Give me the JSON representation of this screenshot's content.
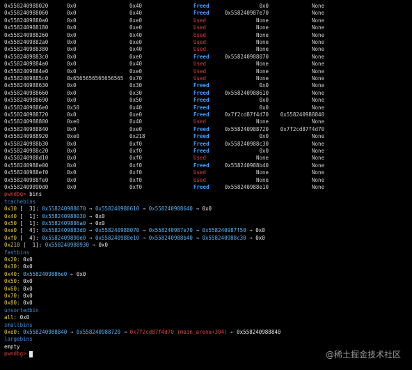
{
  "heap_rows": [
    [
      "0x558240988020",
      "0x0",
      "0x40",
      "Freed",
      "0x0",
      "None"
    ],
    [
      "0x558240988060",
      "0x0",
      "0x40",
      "Freed",
      "0x558240987e70",
      "None"
    ],
    [
      "0x5582409880a0",
      "0x0",
      "0xe0",
      "Used",
      "None",
      "None"
    ],
    [
      "0x558240988180",
      "0x0",
      "0xe0",
      "Used",
      "None",
      "None"
    ],
    [
      "0x558240988260",
      "0x0",
      "0x40",
      "Used",
      "None",
      "None"
    ],
    [
      "0x5582409882a0",
      "0x0",
      "0xe0",
      "Used",
      "None",
      "None"
    ],
    [
      "0x558240988380",
      "0x0",
      "0x40",
      "Used",
      "None",
      "None"
    ],
    [
      "0x5582409883c0",
      "0x0",
      "0xe0",
      "Freed",
      "0x558240988070",
      "None"
    ],
    [
      "0x5582409884a0",
      "0x0",
      "0x40",
      "Used",
      "None",
      "None"
    ],
    [
      "0x5582409884e0",
      "0x0",
      "0xe0",
      "Used",
      "None",
      "None"
    ],
    [
      "0x5582409885c0",
      "0x6565656565656565",
      "0x70",
      "Used",
      "None",
      "None"
    ],
    [
      "0x558240988630",
      "0x0",
      "0x30",
      "Freed",
      "0x0",
      "None"
    ],
    [
      "0x558240988660",
      "0x0",
      "0x30",
      "Freed",
      "0x558240988610",
      "None"
    ],
    [
      "0x558240988690",
      "0x0",
      "0x50",
      "Freed",
      "0x0",
      "None"
    ],
    [
      "0x5582409886e0",
      "0x50",
      "0x40",
      "Freed",
      "0x0",
      "None"
    ],
    [
      "0x558240988720",
      "0x0",
      "0xe0",
      "Freed",
      "0x7f2cd87f4d70",
      "0x558240988840"
    ],
    [
      "0x558240988800",
      "0xe0",
      "0x40",
      "Used",
      "None",
      "None"
    ],
    [
      "0x558240988840",
      "0x0",
      "0xe0",
      "Freed",
      "0x558240988720",
      "0x7f2cd87f4d70"
    ],
    [
      "0x558240988920",
      "0xe0",
      "0x218",
      "Freed",
      "0x0",
      "None"
    ],
    [
      "0x558240988b30",
      "0x0",
      "0xf0",
      "Freed",
      "0x558240988c30",
      "None"
    ],
    [
      "0x558240988c20",
      "0x0",
      "0xf0",
      "Freed",
      "0x0",
      "None"
    ],
    [
      "0x558240988d10",
      "0x0",
      "0xf0",
      "Used",
      "None",
      "None"
    ],
    [
      "0x558240988e00",
      "0x0",
      "0xf0",
      "Freed",
      "0x558240988b40",
      "None"
    ],
    [
      "0x558240988ef0",
      "0x0",
      "0xf0",
      "Used",
      "None",
      "None"
    ],
    [
      "0x558240988fe0",
      "0x0",
      "0xf0",
      "Used",
      "None",
      "None"
    ],
    [
      "0x5582409890d0",
      "0x0",
      "0xf0",
      "Freed",
      "0x558240988e10",
      "None"
    ]
  ],
  "prompt": "pwndbg>",
  "command": "bins",
  "tcache": {
    "title": "tcachebins",
    "rows": [
      {
        "key": "0x30",
        "count": "[  3]:",
        "chain": [
          "0x558240988670",
          "0x558240988610",
          "0x558240988640",
          "0x0"
        ]
      },
      {
        "key": "0x40",
        "count": "[  1]:",
        "chain": [
          "0x558240988030",
          "0x0"
        ]
      },
      {
        "key": "0x50",
        "count": "[  1]:",
        "chain": [
          "0x5582409886a0",
          "0x0"
        ]
      },
      {
        "key": "0xe0",
        "count": "[  4]:",
        "chain": [
          "0x5582409883d0",
          "0x558240988070",
          "0x558240987e70",
          "0x558240987f50",
          "0x0"
        ]
      },
      {
        "key": "0xf0",
        "count": "[  4]:",
        "chain": [
          "0x5582409890e0",
          "0x558240988e10",
          "0x558240988b40",
          "0x558240988c30",
          "0x0"
        ]
      },
      {
        "key": "0x210",
        "count": "[  1]:",
        "chain": [
          "0x558240988930",
          "0x0"
        ]
      }
    ]
  },
  "fastbins": {
    "title": "fastbins",
    "rows": [
      {
        "key": "0x20:",
        "value": "0x0"
      },
      {
        "key": "0x30:",
        "value": "0x0"
      },
      {
        "key": "0x40:",
        "value": "0x5582409886e0",
        "tail": "0x0"
      },
      {
        "key": "0x50:",
        "value": "0x0"
      },
      {
        "key": "0x60:",
        "value": "0x0"
      },
      {
        "key": "0x70:",
        "value": "0x0"
      },
      {
        "key": "0x80:",
        "value": "0x0"
      }
    ]
  },
  "unsorted": {
    "title": "unsortedbin",
    "key": "all:",
    "value": "0x0"
  },
  "small": {
    "title": "smallbins",
    "key": "0xe0:",
    "chain": [
      "0x558240988840",
      "0x558240988720",
      "0x7f2cd87f4d70",
      "0x558240988840"
    ],
    "arena_note": "(main_arena+304)"
  },
  "large": {
    "title": "largebins",
    "value": "empty"
  },
  "watermark": "@稀土掘金技术社区"
}
